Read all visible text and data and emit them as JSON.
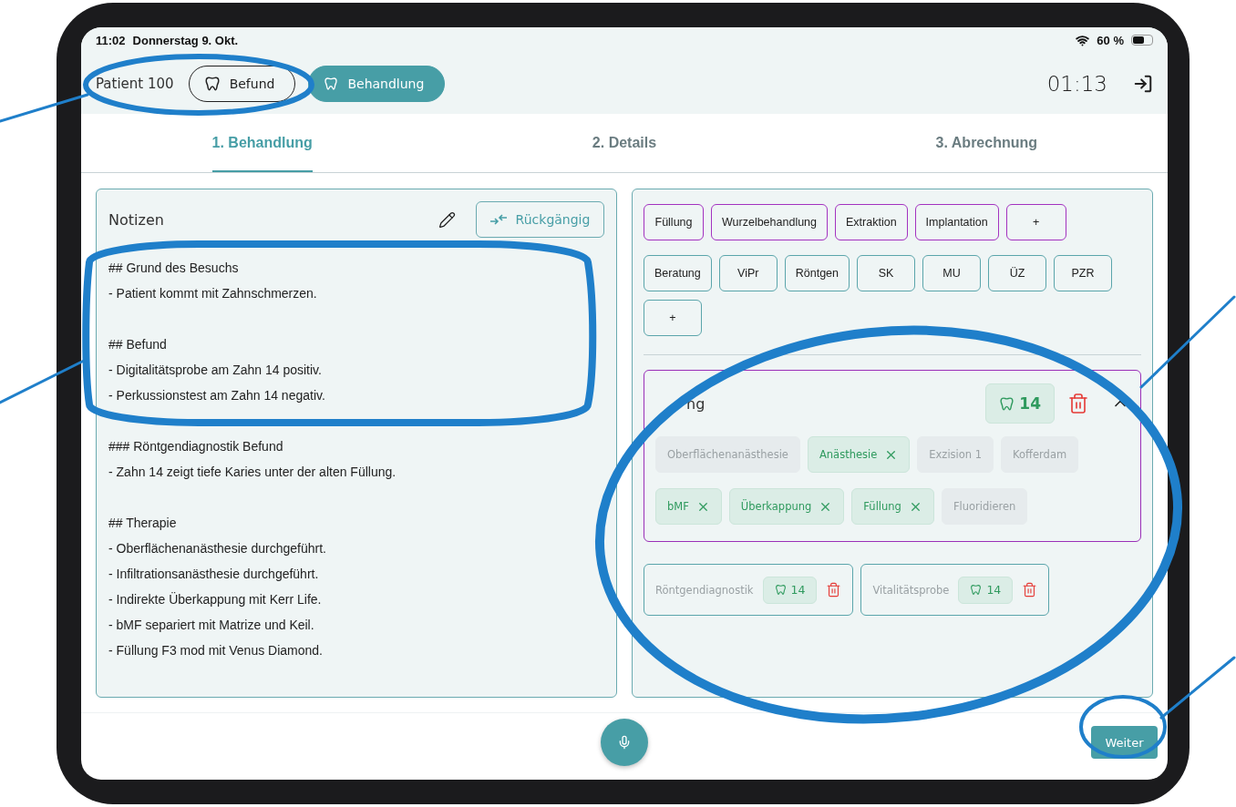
{
  "status_bar": {
    "time": "11:02",
    "date": "Donnerstag 9. Okt.",
    "battery": "60 %"
  },
  "header": {
    "patient": "Patient 100",
    "modes": [
      {
        "label": "Befund",
        "selected": false
      },
      {
        "label": "Behandlung",
        "selected": true
      }
    ],
    "timer": "01:13"
  },
  "steps": [
    {
      "label": "1. Behandlung",
      "selected": true
    },
    {
      "label": "2. Details",
      "selected": false
    },
    {
      "label": "3. Abrechnung",
      "selected": false
    }
  ],
  "notes": {
    "title": "Notizen",
    "undo_button": "Rückgängig",
    "sections": [
      {
        "heading": "## Grund des Besuchs",
        "items": [
          "- Patient kommt mit Zahnschmerzen."
        ]
      },
      {
        "heading": "## Befund",
        "items": [
          "- Digitalitätsprobe am Zahn 14 positiv.",
          "- Perkussionstest am Zahn 14 negativ."
        ]
      },
      {
        "heading": "### Röntgendiagnostik Befund",
        "items": [
          "- Zahn 14 zeigt tiefe Karies unter der alten Füllung."
        ]
      },
      {
        "heading": "## Therapie",
        "items": [
          "- Oberflächenanästhesie durchgeführt.",
          "- Infiltrationsanästhesie durchgeführt.",
          "- Indirekte Überkappung mit Kerr Life.",
          "- bMF separiert mit Matrize und Keil.",
          "- Füllung F3 mod mit Venus Diamond."
        ]
      }
    ]
  },
  "treatment_chips": [
    {
      "label": "Füllung",
      "kind": "treatment"
    },
    {
      "label": "Wurzelbehandlung",
      "kind": "treatment"
    },
    {
      "label": "Extraktion",
      "kind": "treatment"
    },
    {
      "label": "Implantation",
      "kind": "treatment"
    },
    {
      "label": "+",
      "kind": "treatment"
    }
  ],
  "service_chips": [
    {
      "label": "Beratung",
      "kind": "service"
    },
    {
      "label": "ViPr",
      "kind": "service"
    },
    {
      "label": "Röntgen",
      "kind": "service"
    },
    {
      "label": "SK",
      "kind": "service"
    },
    {
      "label": "MU",
      "kind": "service"
    },
    {
      "label": "ÜZ",
      "kind": "service"
    },
    {
      "label": "PZR",
      "kind": "service"
    },
    {
      "label": "+",
      "kind": "service"
    }
  ],
  "active_treatment": {
    "title": "ng",
    "tooth": "14",
    "expanded": true,
    "options": [
      {
        "label": "Oberflächenanästhesie",
        "selected": false
      },
      {
        "label": "Anästhesie",
        "selected": true
      },
      {
        "label": "Exzision 1",
        "selected": false
      },
      {
        "label": "Kofferdam",
        "selected": false
      },
      {
        "label": "bMF",
        "selected": true
      },
      {
        "label": "Überkappung",
        "selected": true
      },
      {
        "label": "Füllung",
        "selected": true
      },
      {
        "label": "Fluoridieren",
        "selected": false
      }
    ]
  },
  "services": [
    {
      "label": "Röntgendiagnostik",
      "tooth": "14"
    },
    {
      "label": "Vitalitätsprobe",
      "tooth": "14"
    }
  ],
  "footer": {
    "next_button": "Weiter"
  }
}
